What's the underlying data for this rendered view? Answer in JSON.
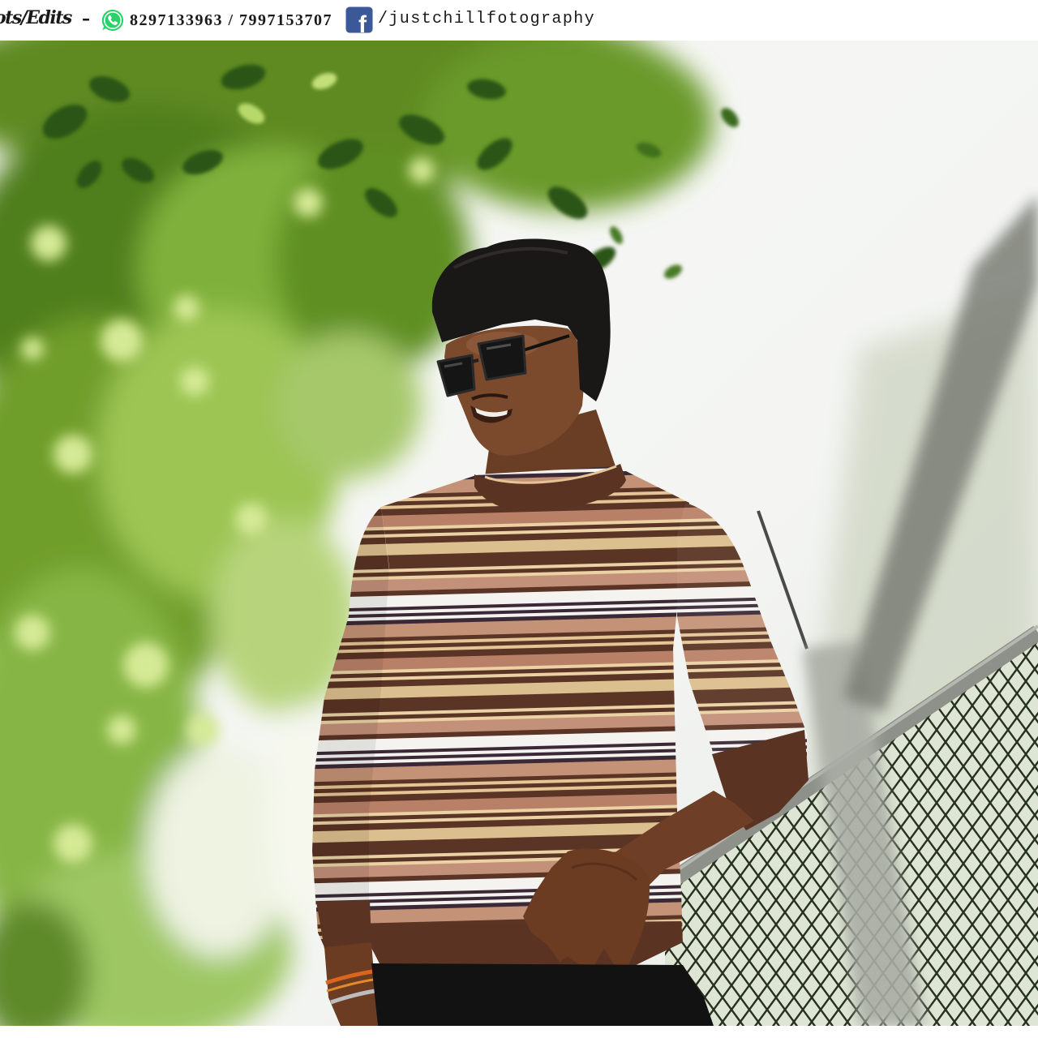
{
  "watermark": {
    "credit_label": "ots/Edits",
    "separator": "–",
    "phone_numbers": "8297133963 / 7997153707",
    "facebook_handle": "/justchillfotography",
    "facebook_logo_letter": "f",
    "icons": {
      "whatsapp": "whatsapp-icon",
      "facebook": "facebook-icon"
    }
  },
  "colors": {
    "banner_background": "#ffffff",
    "text": "#1a1a1a",
    "whatsapp_green": "#25d366",
    "facebook_blue": "#3b5998"
  }
}
